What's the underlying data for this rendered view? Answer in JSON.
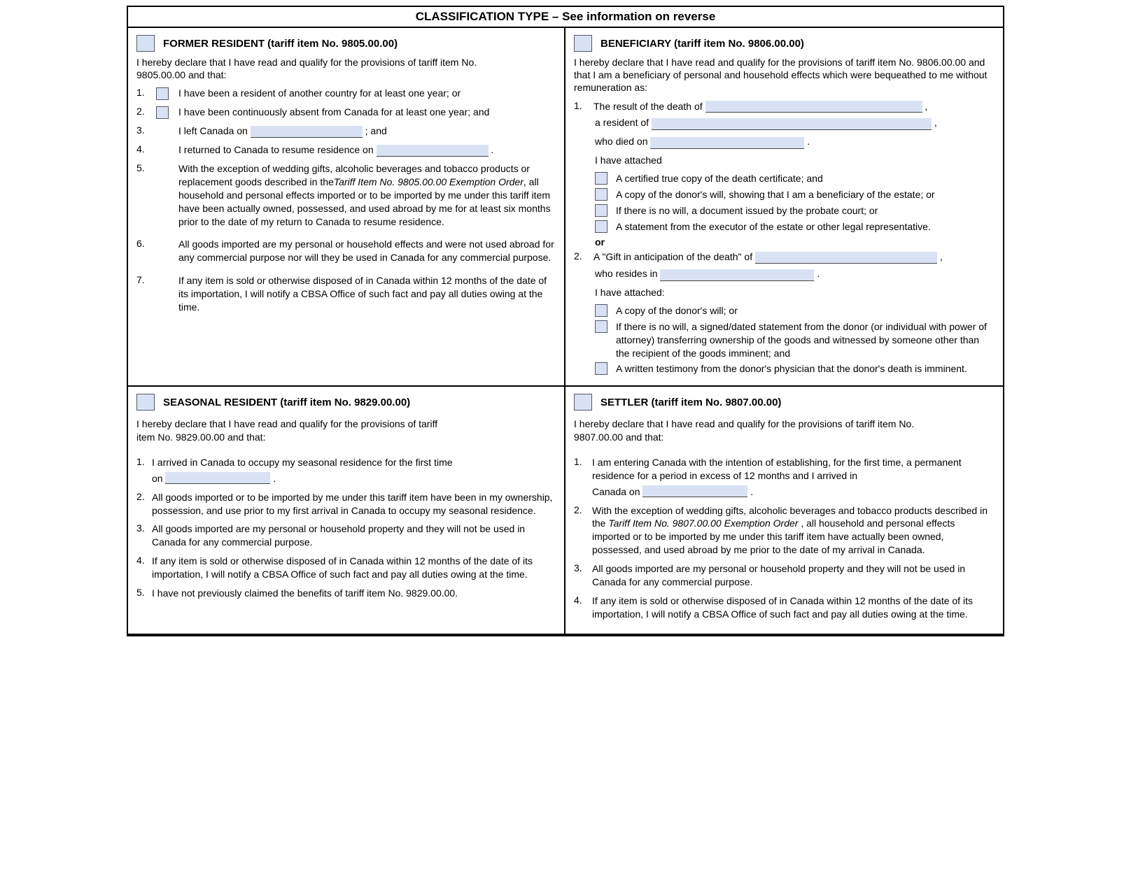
{
  "header": "CLASSIFICATION TYPE – See information on reverse",
  "former": {
    "title": "FORMER RESIDENT (tariff item No. 9805.00.00)",
    "intro": "I hereby declare that I have read and qualify for the provisions of tariff item No. 9805.00.00 and that:",
    "i1": "I have been a resident of another country for at least one year; or",
    "i2": "I have been continuously absent from Canada for at least one year; and",
    "i3a": "I left Canada on ",
    "i3b": " ; and",
    "i4a": "I returned to Canada to resume residence on ",
    "i4b": " .",
    "i5a": "With the exception of wedding gifts, alcoholic beverages and tobacco products or replacement goods described in the",
    "i5italic": "Tariff Item No. 9805.00.00 Exemption Order",
    "i5b": ", all household and personal effects imported or to be imported by me under this tariff item have been actually owned, possessed, and used abroad by me for at least six months prior to the date of my return to Canada to resume residence.",
    "i6": "All goods imported are my personal or household effects and were not used abroad for any commercial purpose nor will they be used in Canada for any commercial purpose.",
    "i7": "If any item is sold or otherwise disposed of in Canada within 12 months of the date of its importation, I will notify a CBSA Office of such fact and pay all duties owing at the time."
  },
  "beneficiary": {
    "title": "BENEFICIARY (tariff item No. 9806.00.00)",
    "intro": "I hereby declare that I have read and qualify for the provisions of tariff item No. 9806.00.00 and that I am a beneficiary of personal and household effects which were bequeathed to me without remuneration as:",
    "i1": "The result of the death of",
    "residentOf": "a resident of",
    "whoDied": "who died on",
    "attached": "I have attached",
    "a1": "A certified true copy of the death certificate; and",
    "a2": "A copy of the donor's will, showing that I am a beneficiary of the estate; or",
    "a3": "If there is no will, a document issued by the probate court; or",
    "a4": "A statement from the executor of the estate or other legal representative.",
    "or": "or",
    "i2": "A \"Gift in anticipation of the death\" of ",
    "whoResides": "who resides in",
    "attached2": "I have attached:",
    "b1": "A copy of the donor's will; or",
    "b2": "If there is no will, a signed/dated statement from the donor (or individual with power of attorney) transferring ownership of the goods and witnessed by someone other than the recipient of the goods imminent; and",
    "b3": "A written testimony from the donor's physician that the donor's death is  imminent."
  },
  "seasonal": {
    "title": "SEASONAL RESIDENT (tariff item No. 9829.00.00)",
    "intro": "I hereby declare that I have read and qualify for the provisions of tariff item No. 9829.00.00 and that:",
    "i1a": "I arrived in Canada to occupy my seasonal residence for the first time",
    "i1on": "on ",
    "i1b": " .",
    "i2": "All goods imported or to be imported by me under this tariff item have been in my ownership, possession, and use prior to my first arrival in Canada to occupy my seasonal residence.",
    "i3": "All goods imported are my personal or household property and they will not be used in Canada for any commercial purpose.",
    "i4": "If any item is sold or otherwise disposed of in Canada within 12 months of the date of its importation, I will notify a CBSA Office of such fact and pay all duties owing at the time.",
    "i5": "I have not previously claimed the benefits of tariff item No. 9829.00.00."
  },
  "settler": {
    "title": "SETTLER (tariff item No. 9807.00.00)",
    "intro": "I hereby declare that I have read and qualify for the provisions of tariff item No. 9807.00.00 and that:",
    "i1a": "I am entering Canada with the intention of establishing, for the first time, a permanent residence for a period in excess of 12 months and I arrived in",
    "i1can": "Canada on ",
    "i1b": " .",
    "i2a": "With the exception of wedding gifts, alcoholic beverages and tobacco products described in the ",
    "i2italic": " Tariff Item No. 9807.00.00 Exemption Order ",
    "i2b": ", all household and personal effects imported or to be imported by me under this tariff item have actually been owned, possessed, and used abroad by me prior to the date of my arrival in Canada.",
    "i3": "All goods imported are my personal or household property and they will not be used in Canada for any commercial purpose.",
    "i4": "If any item is sold or otherwise disposed of in Canada within 12 months of the date of its importation, I will notify a CBSA Office of such fact and pay all duties owing at the time."
  }
}
